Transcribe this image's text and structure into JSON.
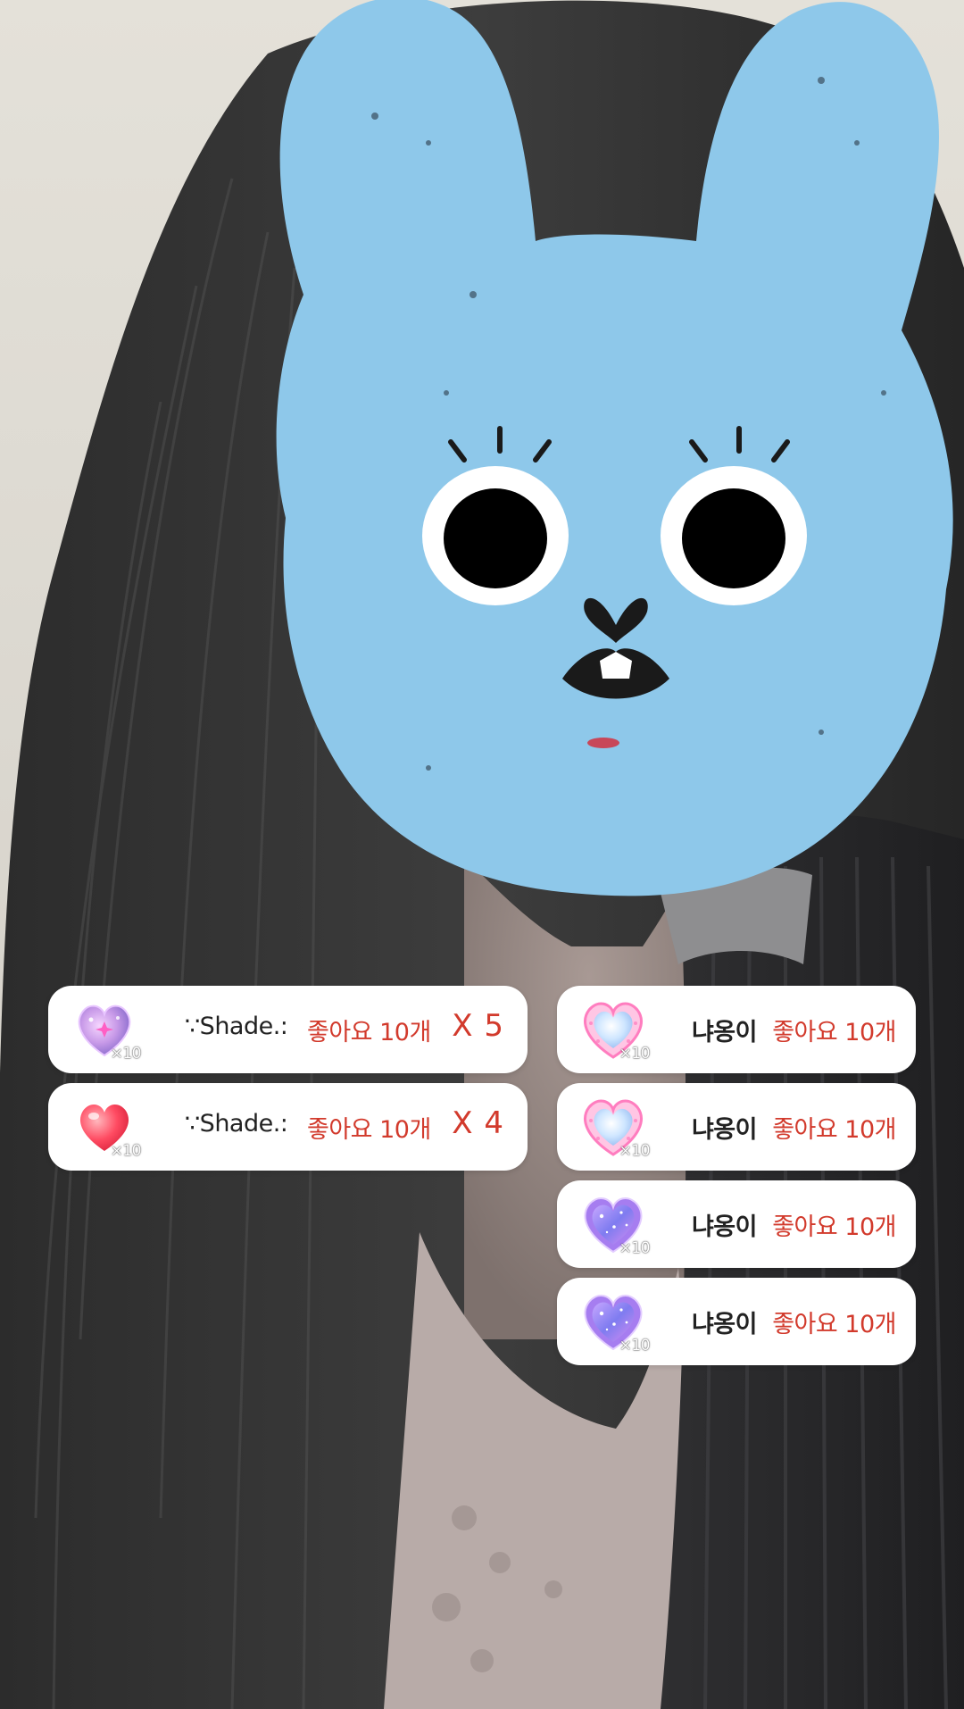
{
  "colors": {
    "card_background": "#ffffff",
    "like_text": "#d23a2c",
    "name_text": "#222222",
    "mask_blue": "#8ec8ea"
  },
  "scene": {
    "mask_icon": "blue-bunny-face-sticker"
  },
  "gift_alerts_left": [
    {
      "sender": "∵Shade.:",
      "likes": "좋아요 10개",
      "combo": "X 5",
      "gift_icon": "glitter-heart-icon",
      "gift_count": "×10"
    },
    {
      "sender": "∵Shade.:",
      "likes": "좋아요 10개",
      "combo": "X 4",
      "gift_icon": "red-heart-icon",
      "gift_count": "×10"
    }
  ],
  "gift_alerts_right": [
    {
      "sender": "냐옹이",
      "likes": "좋아요 10개",
      "gift_icon": "framed-heart-icon",
      "gift_count": "×10"
    },
    {
      "sender": "냐옹이",
      "likes": "좋아요 10개",
      "gift_icon": "framed-heart-icon",
      "gift_count": "×10"
    },
    {
      "sender": "냐옹이",
      "likes": "좋아요 10개",
      "gift_icon": "galaxy-heart-icon",
      "gift_count": "×10"
    },
    {
      "sender": "냐옹이",
      "likes": "좋아요 10개",
      "gift_icon": "galaxy-heart-icon",
      "gift_count": "×10"
    }
  ]
}
